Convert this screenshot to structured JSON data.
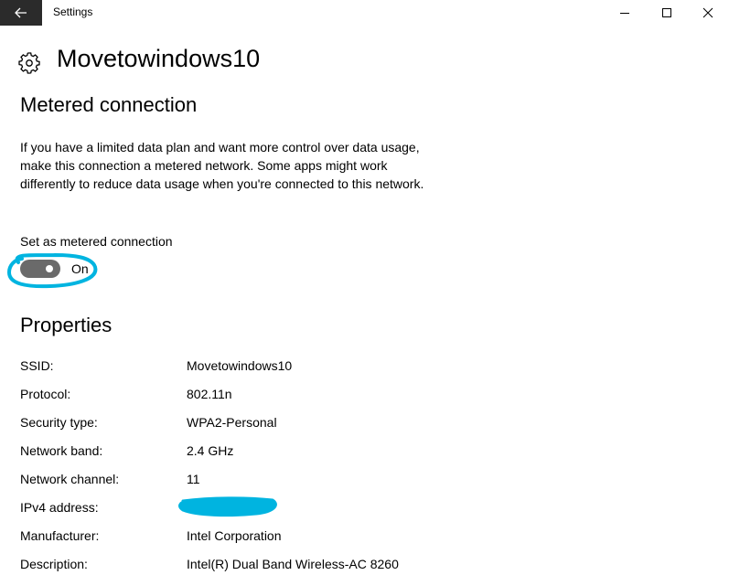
{
  "window": {
    "title": "Settings"
  },
  "page": {
    "title": "Movetowindows10",
    "icon": "gear-icon"
  },
  "metered": {
    "heading": "Metered connection",
    "description": "If you have a limited data plan and want more control over data usage, make this connection a metered network. Some apps might work differently to reduce data usage when you're connected to this network.",
    "toggle_label": "Set as metered connection",
    "toggle_state": "On",
    "toggle_on": true
  },
  "properties": {
    "heading": "Properties",
    "rows": [
      {
        "label": "SSID:",
        "value": "Movetowindows10"
      },
      {
        "label": "Protocol:",
        "value": "802.11n"
      },
      {
        "label": "Security type:",
        "value": "WPA2-Personal"
      },
      {
        "label": "Network band:",
        "value": "2.4 GHz"
      },
      {
        "label": "Network channel:",
        "value": "11"
      },
      {
        "label": "IPv4 address:",
        "value": ""
      },
      {
        "label": "Manufacturer:",
        "value": "Intel Corporation"
      },
      {
        "label": "Description:",
        "value": "Intel(R) Dual Band Wireless-AC 8260"
      }
    ]
  },
  "colors": {
    "annotation": "#00b4e0",
    "title_back": "#2b2b2b",
    "toggle_track": "#6a6a6a"
  }
}
